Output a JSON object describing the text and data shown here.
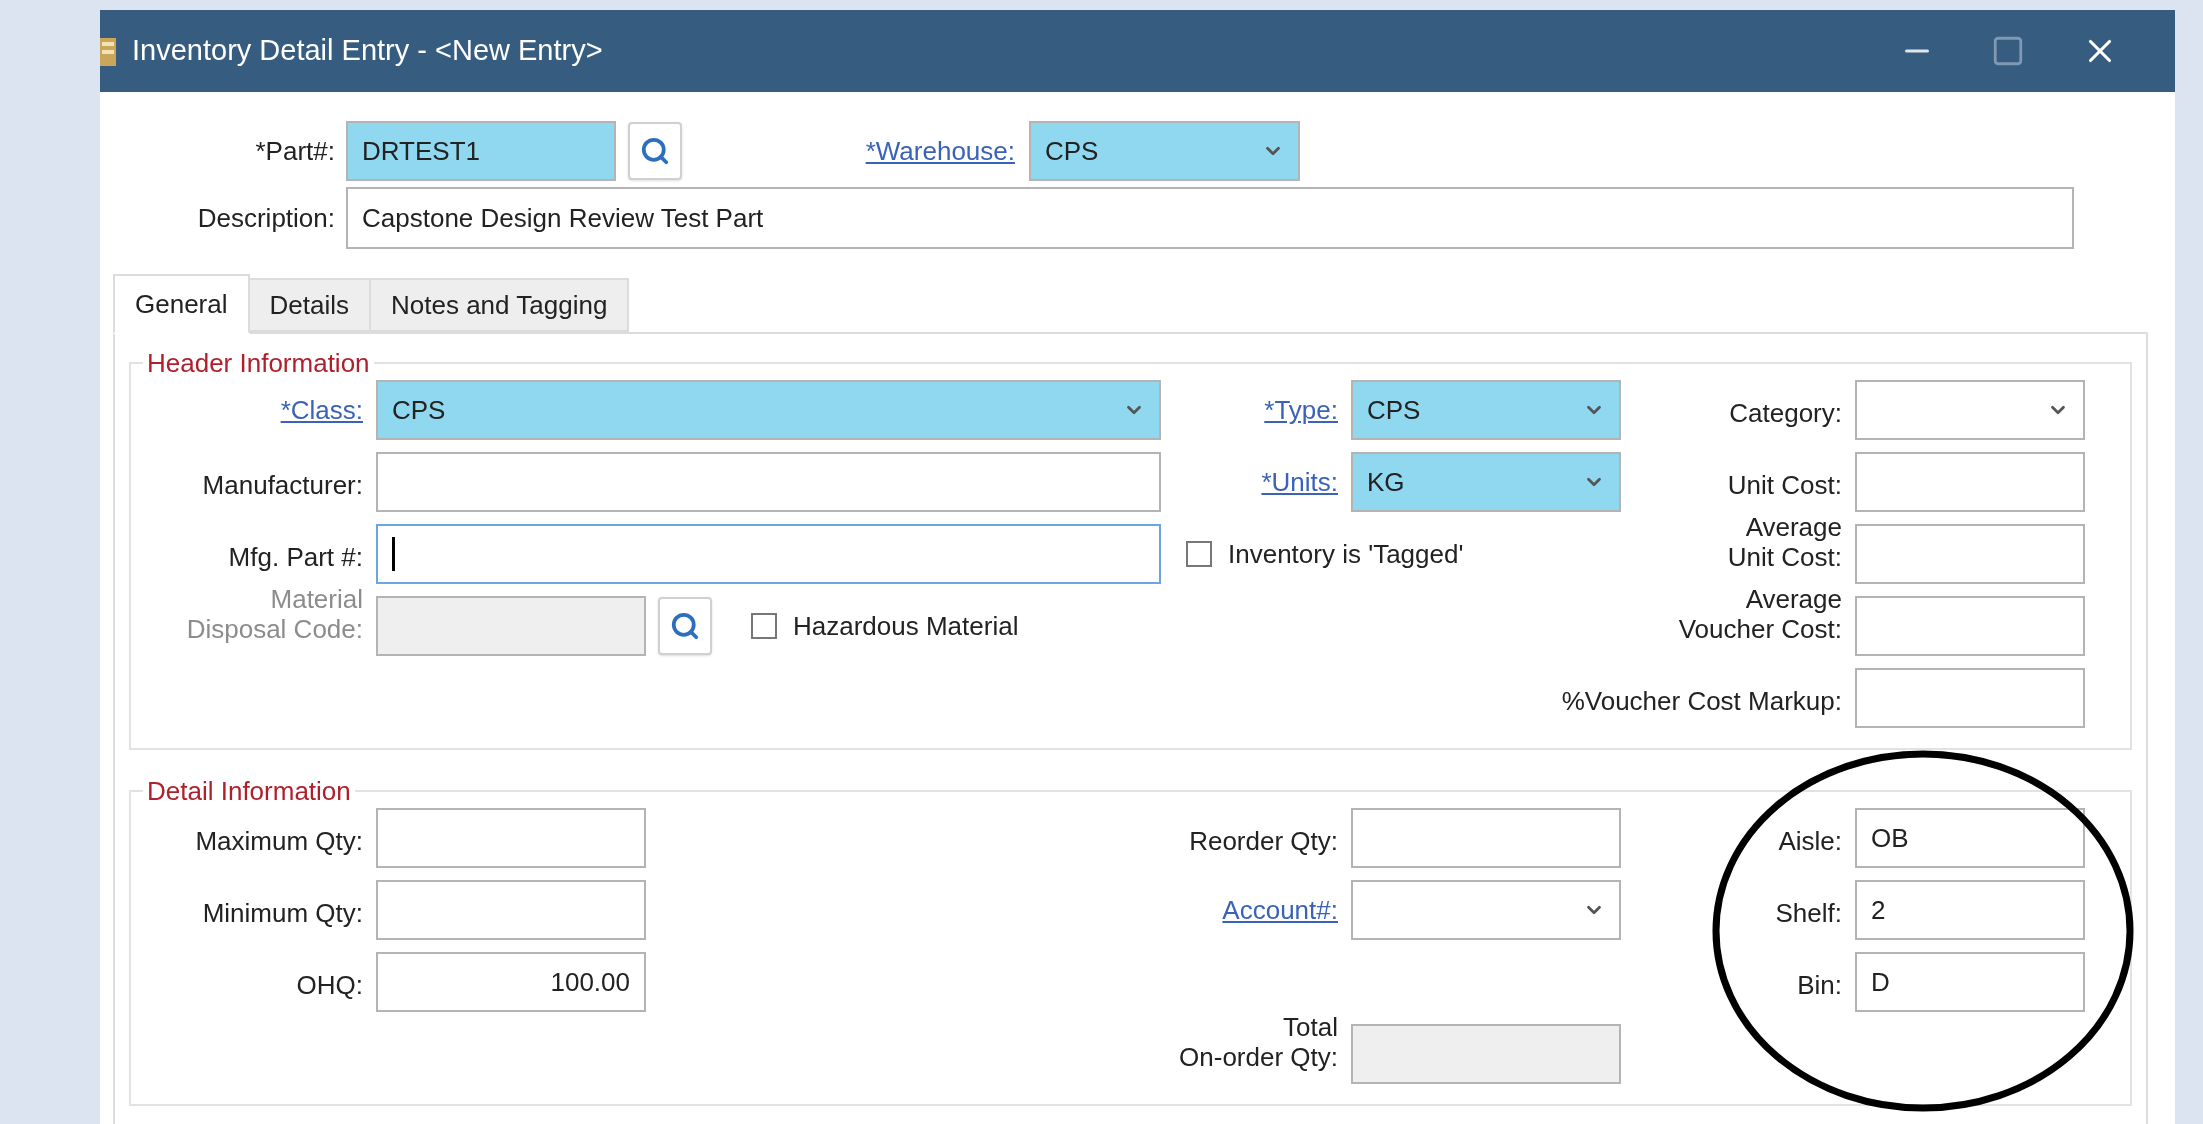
{
  "window": {
    "title": "Inventory Detail Entry - <New Entry>"
  },
  "part": {
    "label": "*Part#:",
    "value": "DRTEST1",
    "highlighted": true
  },
  "warehouse": {
    "label": "*Warehouse:",
    "value": "CPS",
    "link": true,
    "highlighted": true
  },
  "description": {
    "label": "Description:",
    "value": "Capstone Design Review Test Part"
  },
  "tabs": [
    {
      "label": "General",
      "selected": true
    },
    {
      "label": "Details",
      "selected": false
    },
    {
      "label": "Notes and Tagging",
      "selected": false
    }
  ],
  "header_information": {
    "title": "Header Information",
    "fields": [
      {
        "kind": "combo",
        "label": "*Class:",
        "value": "CPS",
        "link": true,
        "highlighted": true
      },
      {
        "kind": "combo",
        "label": "*Type:",
        "value": "CPS",
        "link": true,
        "highlighted": true
      },
      {
        "kind": "combo",
        "label": "Category:"
      },
      {
        "kind": "text",
        "label": "Manufacturer:"
      },
      {
        "kind": "combo",
        "label": "*Units:",
        "value": "KG",
        "link": true,
        "highlighted": true
      },
      {
        "kind": "text",
        "label": "Unit Cost:"
      },
      {
        "kind": "text",
        "label": "Mfg. Part #:",
        "focused": true
      },
      {
        "kind": "checkbox",
        "label": "Inventory is 'Tagged'",
        "checked": false
      },
      {
        "kind": "text",
        "label": "Average\nUnit Cost:"
      },
      {
        "kind": "lookup",
        "label": "Material\nDisposal Code:",
        "disabled": true,
        "label_disabled": true
      },
      {
        "kind": "checkbox",
        "label": "Hazardous Material",
        "checked": false
      },
      {
        "kind": "text",
        "label": "Average\nVoucher Cost:"
      },
      {
        "kind": "text",
        "label": "%Voucher Cost Markup:"
      }
    ]
  },
  "detail_information": {
    "title": "Detail Information",
    "fields": [
      {
        "kind": "text",
        "label": "Maximum Qty:"
      },
      {
        "kind": "text",
        "label": "Reorder Qty:"
      },
      {
        "kind": "text",
        "label": "Aisle:",
        "value": "OB"
      },
      {
        "kind": "text",
        "label": "Minimum Qty:"
      },
      {
        "kind": "combo",
        "label": "Account#:",
        "link": true
      },
      {
        "kind": "text",
        "label": "Shelf:",
        "value": "2"
      },
      {
        "kind": "number",
        "label": "OHQ:",
        "value": "100.00"
      },
      {
        "kind": "text",
        "label": "Bin:",
        "value": "D"
      },
      {
        "kind": "text",
        "label": "Total\nOn-order Qty:",
        "disabled": true
      }
    ]
  }
}
